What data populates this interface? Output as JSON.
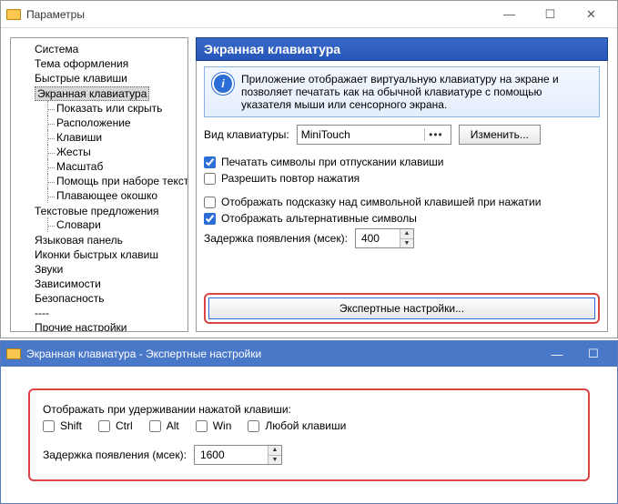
{
  "main_window": {
    "title": "Параметры",
    "tree": {
      "items": [
        "Система",
        "Тема оформления",
        "Быстрые клавиши"
      ],
      "osk": {
        "label": "Экранная клавиатура",
        "children": [
          "Показать или скрыть",
          "Расположение",
          "Клавиши",
          "Жесты",
          "Масштаб",
          "Помощь при наборе текста",
          "Плавающее окошко"
        ]
      },
      "text_suggestions": {
        "label": "Текстовые предложения",
        "children": [
          "Словари"
        ]
      },
      "rest": [
        "Языковая панель",
        "Иконки быстрых клавиш",
        "Звуки",
        "Зависимости",
        "Безопасность",
        "----",
        "Прочие настройки"
      ]
    },
    "panel": {
      "header": "Экранная клавиатура",
      "info": "Приложение отображает виртуальную клавиатуру на экране и позволяет печатать как на обычной клавиатуре с помощью указателя мыши или сенсорного экрана.",
      "kbd_type_label": "Вид клавиатуры:",
      "kbd_type_value": "MiniTouch",
      "change_btn": "Изменить...",
      "chk_release": "Печатать символы при отпускании клавиши",
      "chk_repeat": "Разрешить повтор нажатия",
      "chk_hint": "Отображать подсказку над символьной клавишей при нажатии",
      "chk_alt": "Отображать альтернативные символы",
      "delay_label": "Задержка появления (мсек):",
      "delay_value": "400",
      "expert_btn": "Экспертные настройки..."
    }
  },
  "expert_window": {
    "title": "Экранная клавиатура - Экспертные настройки",
    "hold_label": "Отображать при удерживании нажатой клавиши:",
    "mods": {
      "shift": "Shift",
      "ctrl": "Ctrl",
      "alt": "Alt",
      "win": "Win",
      "any": "Любой клавиши"
    },
    "delay_label": "Задержка появления (мсек):",
    "delay_value": "1600"
  }
}
